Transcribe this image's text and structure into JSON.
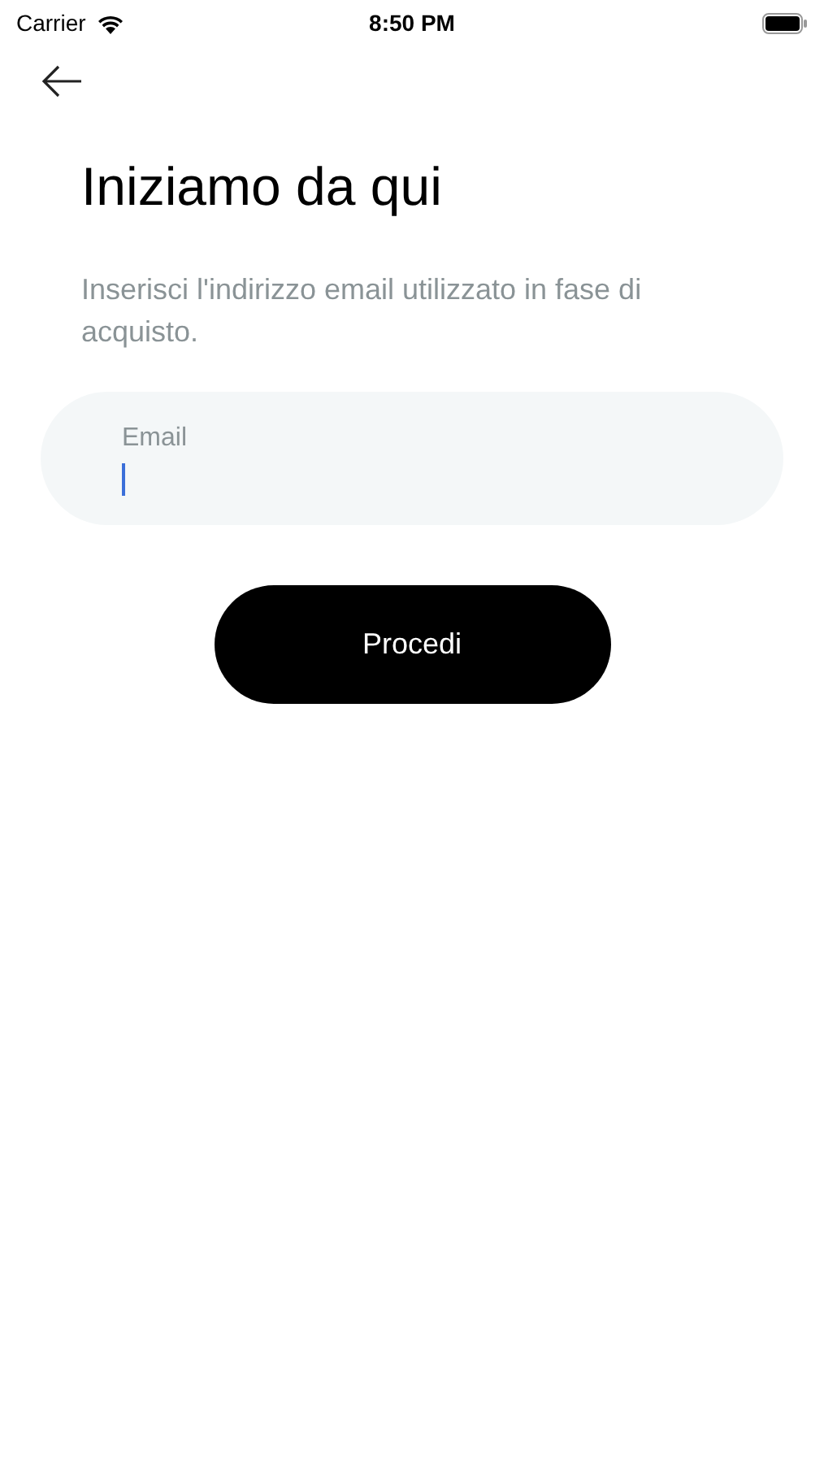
{
  "status_bar": {
    "carrier": "Carrier",
    "time": "8:50 PM"
  },
  "title": "Iniziamo da qui",
  "description": "Inserisci l'indirizzo email utilizzato in fase di acquisto.",
  "email_field": {
    "label": "Email",
    "focused": true
  },
  "buttons": [
    "Procedi"
  ]
}
